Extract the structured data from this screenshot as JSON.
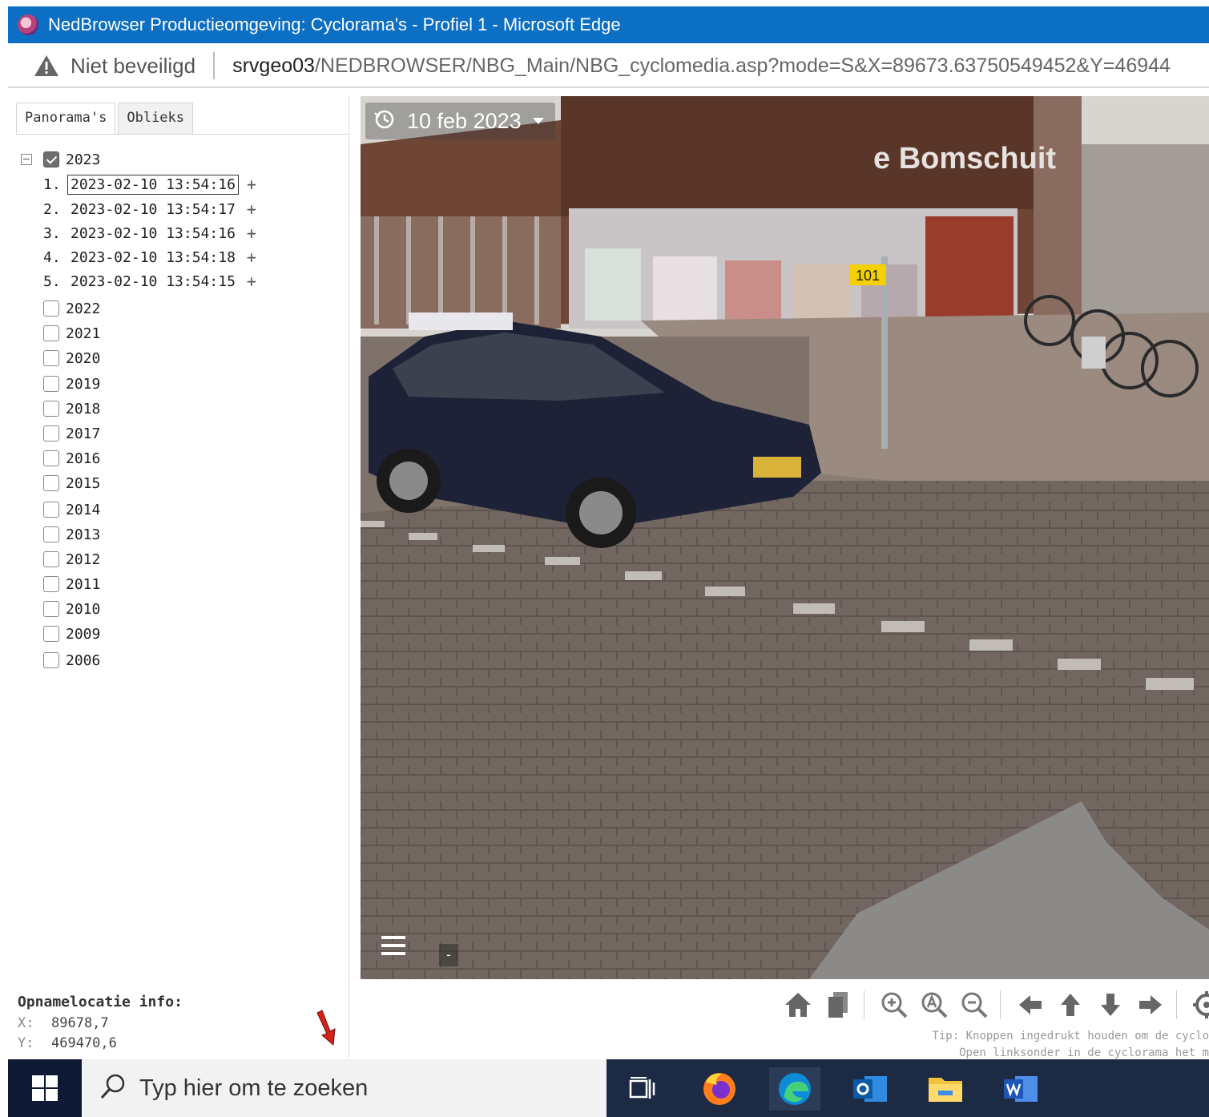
{
  "window": {
    "title": "NedBrowser Productieomgeving: Cyclorama's - Profiel 1 - Microsoft Edge"
  },
  "address": {
    "security_label": "Niet beveiligd",
    "url_host": "srvgeo03",
    "url_path": "/NEDBROWSER/NBG_Main/NBG_cyclomedia.asp?mode=S&X=89673.63750549452&Y=46944"
  },
  "tabs": [
    {
      "label": "Panorama's",
      "active": true
    },
    {
      "label": "Oblieks",
      "active": false
    }
  ],
  "tree": {
    "year_2023": "2023",
    "recordings": [
      {
        "index": "1.",
        "timestamp": "2023-02-10 13:54:16",
        "selected": true
      },
      {
        "index": "2.",
        "timestamp": "2023-02-10 13:54:17",
        "selected": false
      },
      {
        "index": "3.",
        "timestamp": "2023-02-10 13:54:16",
        "selected": false
      },
      {
        "index": "4.",
        "timestamp": "2023-02-10 13:54:18",
        "selected": false
      },
      {
        "index": "5.",
        "timestamp": "2023-02-10 13:54:15",
        "selected": false
      }
    ],
    "plus_glyph": "+",
    "years": [
      "2022",
      "2021",
      "2020",
      "2019",
      "2018",
      "2017",
      "2016",
      "2015",
      "2014",
      "2013",
      "2012",
      "2011",
      "2010",
      "2009",
      "2006"
    ]
  },
  "location_info": {
    "header": "Opnamelocatie info:",
    "x_label": "X:",
    "x_value": "89678,7",
    "y_label": "Y:",
    "y_value": "469470,6"
  },
  "viewer": {
    "date_label": "10 feb 2023",
    "sign_text": "e Bomschuit",
    "stop_number": "101",
    "mini_button": "-"
  },
  "toolbar_icons": [
    "home-icon",
    "copy-icon",
    "zoom-in-icon",
    "zoom-reset-icon",
    "zoom-out-icon",
    "arrow-left-icon",
    "arrow-up-icon",
    "arrow-down-icon",
    "arrow-right-icon",
    "settings-icon"
  ],
  "tip": {
    "line1": "Tip: Knoppen ingedrukt houden om de cyclo",
    "line2": "Open linksonder in de cyclorama het m"
  },
  "taskbar": {
    "search_placeholder": "Typ hier om te zoeken"
  },
  "colors": {
    "titlebar": "#0b6fc4",
    "taskbar": "#1c2a44",
    "selection_border": "#333333"
  }
}
